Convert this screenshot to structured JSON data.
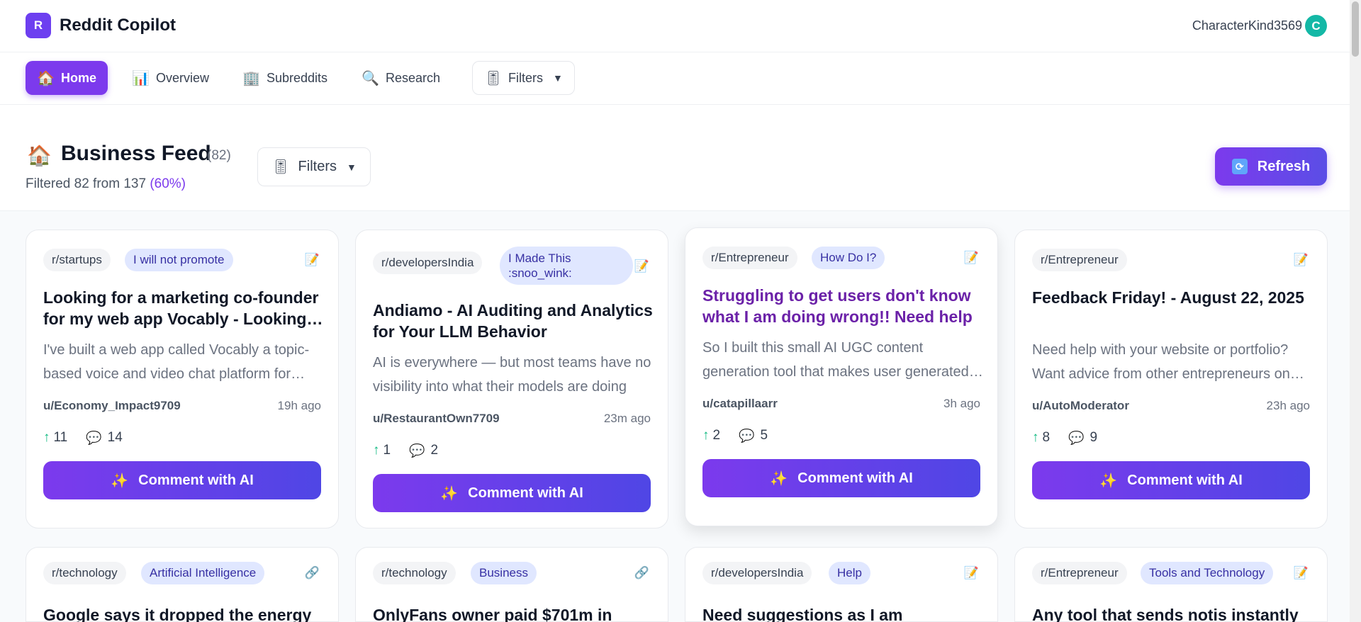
{
  "app": {
    "logo_letter": "R",
    "title": "Reddit Copilot"
  },
  "user": {
    "name": "CharacterKind3569",
    "avatar_letter": "C"
  },
  "nav": {
    "items": [
      {
        "label": "Home",
        "icon": "house-icon",
        "glyph": "🏠"
      },
      {
        "label": "Overview",
        "icon": "bar-chart-icon",
        "glyph": "📊"
      },
      {
        "label": "Subreddits",
        "icon": "building-icon",
        "glyph": "🏢"
      },
      {
        "label": "Research",
        "icon": "magnifier-icon",
        "glyph": "🔍"
      }
    ],
    "filters_label": "Filters",
    "filters_glyph": "🎚",
    "caret": "▼"
  },
  "feed": {
    "icon": "🏠",
    "title": "Business Feed",
    "count": "(82)",
    "summary_prefix": "Filtered 82 from 137",
    "summary_pct": "(60%)",
    "filters_label": "Filters",
    "refresh_label": "Refresh",
    "refresh_glyph": "🔄"
  },
  "comment_button_label": "Comment with AI",
  "comment_button_glyph": "✨",
  "posts": [
    {
      "subreddit": "r/startups",
      "flair": "I will not promote",
      "type_icon": "📝",
      "title": "Looking for a marketing co-founder for my web app Vocably - Looking for AI builder from India",
      "excerpt": "I've built a web app called Vocably a topic-based voice and video chat platform for learners",
      "author": "u/Economy_Impact9709",
      "ago": "19h ago",
      "upvotes": "11",
      "comments": "14"
    },
    {
      "subreddit": "r/developersIndia",
      "flair": "I Made This :snoo_wink:",
      "type_icon": "📝",
      "title": "Andiamo - AI Auditing and Analytics for Your LLM Behavior",
      "excerpt": "AI is everywhere — but most teams have no visibility into what their models are doing",
      "author": "u/RestaurantOwn7709",
      "ago": "23m ago",
      "upvotes": "1",
      "comments": "2"
    },
    {
      "subreddit": "r/Entrepreneur",
      "flair": "How Do I?",
      "type_icon": "📝",
      "title": "Struggling to get users don't know what I am doing wrong!! Need help",
      "excerpt": "So I built this small AI UGC content generation tool that makes user generated content videos",
      "author": "u/catapillaarr",
      "ago": "3h ago",
      "upvotes": "2",
      "comments": "5"
    },
    {
      "subreddit": "r/Entrepreneur",
      "flair": "",
      "type_icon": "📝",
      "title": "Feedback Friday! - August 22, 2025",
      "excerpt": "Need help with your website or portfolio? Want advice from other entrepreneurs on your business",
      "author": "u/AutoModerator",
      "ago": "23h ago",
      "upvotes": "8",
      "comments": "9"
    },
    {
      "subreddit": "r/technology",
      "flair": "Artificial Intelligence",
      "type_icon": "🔗",
      "title": "Google says it dropped the energy"
    },
    {
      "subreddit": "r/technology",
      "flair": "Business",
      "type_icon": "🔗",
      "title": "OnlyFans owner paid $701m in"
    },
    {
      "subreddit": "r/developersIndia",
      "flair": "Help",
      "type_icon": "📝",
      "title": "Need suggestions as I am"
    },
    {
      "subreddit": "r/Entrepreneur",
      "flair": "Tools and Technology",
      "type_icon": "📝",
      "title": "Any tool that sends notis instantly"
    }
  ]
}
